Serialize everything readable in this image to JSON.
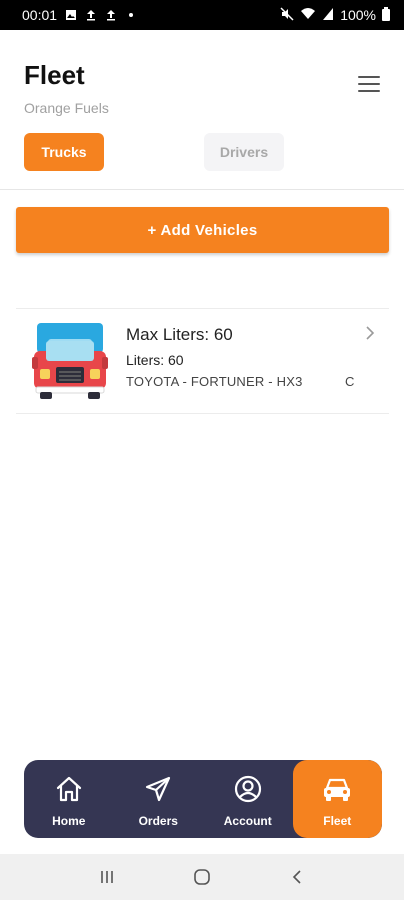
{
  "status_bar": {
    "time": "00:01",
    "battery": "100%",
    "icons": [
      "image-icon",
      "upload-icon",
      "upload-icon",
      "dot-icon",
      "mute-icon",
      "wifi-icon",
      "signal-icon",
      "battery-icon"
    ]
  },
  "header": {
    "title": "Fleet",
    "subtitle": "Orange Fuels",
    "menu_icon": "hamburger-menu-icon"
  },
  "tabs": [
    {
      "label": "Trucks",
      "active": true
    },
    {
      "label": "Drivers",
      "active": false
    }
  ],
  "add_button": {
    "label": "+ Add Vehicles"
  },
  "vehicles": [
    {
      "max_liters": "Max Liters: 60",
      "liters": "Liters: 60",
      "description": "TOYOTA - FORTUNER - HX3",
      "extra": "C",
      "icon": "truck-icon"
    }
  ],
  "bottom_nav": [
    {
      "label": "Home",
      "icon": "home-icon",
      "active": false
    },
    {
      "label": "Orders",
      "icon": "send-icon",
      "active": false
    },
    {
      "label": "Account",
      "icon": "account-icon",
      "active": false
    },
    {
      "label": "Fleet",
      "icon": "car-icon",
      "active": true
    }
  ],
  "colors": {
    "accent": "#f5821f",
    "nav_bg": "#353653",
    "subtitle": "#a0a0a0"
  }
}
